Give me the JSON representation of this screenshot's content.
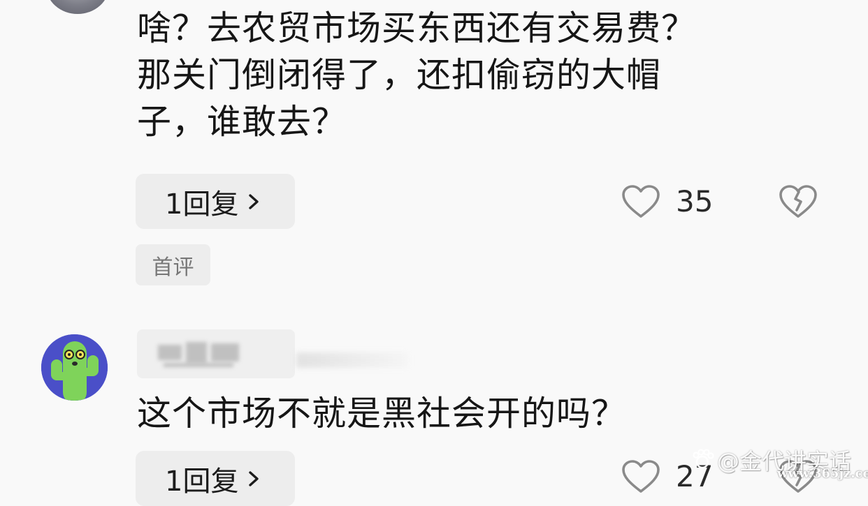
{
  "comments": [
    {
      "text_lines": [
        "啥？去农贸市场买东西还有交易费？",
        "那关门倒闭得了，还扣偷窃的大帽",
        "子，谁敢去？"
      ],
      "reply_label": "1回复",
      "like_count": "35",
      "badge": "首评"
    },
    {
      "text_lines": [
        "这个市场不就是黑社会开的吗？"
      ],
      "reply_label": "1回复",
      "like_count": "27"
    }
  ],
  "watermark": {
    "text": "@金代讲实话",
    "url": "www.365jz.com"
  },
  "icons": {
    "like": "heart-outline-icon",
    "dislike": "broken-heart-icon",
    "reply_chevron": "chevron-right-icon"
  },
  "colors": {
    "background": "#f9f9f9",
    "pill": "#ededed",
    "text": "#161616",
    "icon": "#8a8a8a",
    "avatar_bg": "#4a4fc8",
    "cactus": "#7fd35a"
  }
}
